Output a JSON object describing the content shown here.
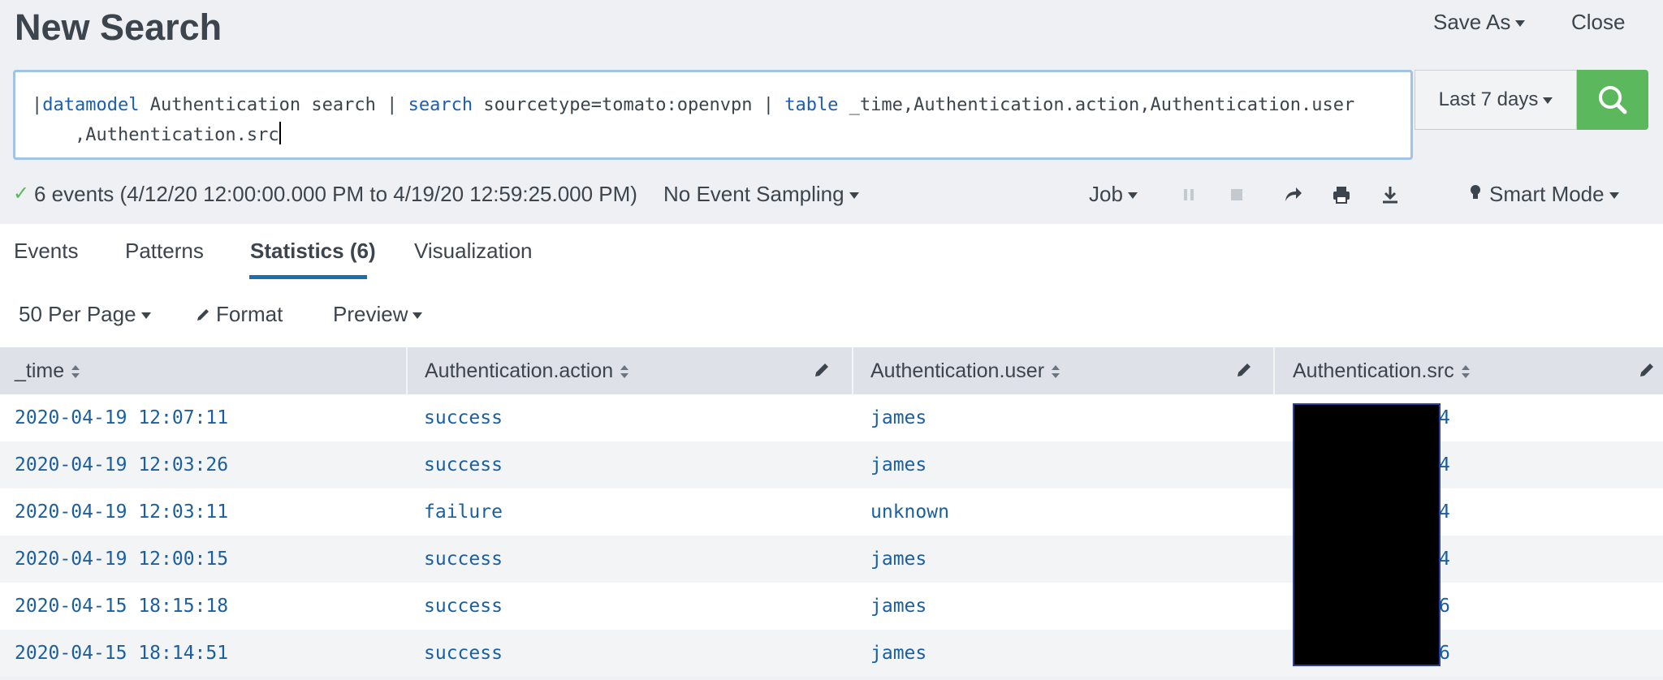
{
  "header": {
    "title": "New Search",
    "save_as": "Save As",
    "close": "Close"
  },
  "search": {
    "query_parts": [
      {
        "t": "|",
        "kw": false
      },
      {
        "t": "datamodel",
        "kw": true
      },
      {
        "t": " Authentication search | ",
        "kw": false
      },
      {
        "t": "search",
        "kw": true
      },
      {
        "t": " sourcetype=tomato:openvpn | ",
        "kw": false
      },
      {
        "t": "table",
        "kw": true
      },
      {
        "t": " _time,Authentication.action,Authentication.user\n    ,Authentication.src",
        "kw": false
      }
    ],
    "time_range": "Last 7 days"
  },
  "status": {
    "event_summary": "6 events (4/12/20 12:00:00.000 PM to 4/19/20 12:59:25.000 PM)",
    "sampling": "No Event Sampling",
    "job": "Job",
    "mode": "Smart Mode"
  },
  "tabs": [
    {
      "label": "Events"
    },
    {
      "label": "Patterns"
    },
    {
      "label": "Statistics (6)"
    },
    {
      "label": "Visualization"
    }
  ],
  "toolbar": {
    "per_page": "50 Per Page",
    "format": "Format",
    "preview": "Preview"
  },
  "table": {
    "columns": [
      "_time",
      "Authentication.action",
      "Authentication.user",
      "Authentication.src"
    ],
    "rows": [
      [
        "2020-04-19 12:07:11",
        "success",
        "james",
        "4"
      ],
      [
        "2020-04-19 12:03:26",
        "success",
        "james",
        "4"
      ],
      [
        "2020-04-19 12:03:11",
        "failure",
        "unknown",
        "4"
      ],
      [
        "2020-04-19 12:00:15",
        "success",
        "james",
        "4"
      ],
      [
        "2020-04-15 18:15:18",
        "success",
        "james",
        "6"
      ],
      [
        "2020-04-15 18:14:51",
        "success",
        "james",
        "6"
      ]
    ]
  },
  "colors": {
    "accent_green": "#5cb85c",
    "link_blue": "#1a5fa0",
    "tab_underline": "#1a6fb0"
  }
}
